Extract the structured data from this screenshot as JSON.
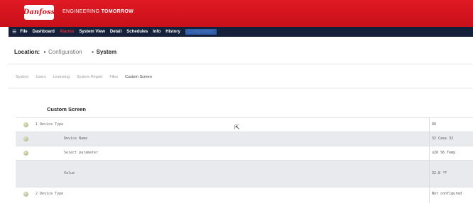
{
  "header": {
    "logo_text": "Danfoss",
    "tagline_a": "ENGINEERING",
    "tagline_b": "TOMORROW"
  },
  "menu": {
    "icon": "hamburger-icon",
    "items": [
      "File",
      "Dashboard",
      "Alarms",
      "System View",
      "Detail",
      "Schedules",
      "Info",
      "History",
      "Configuration"
    ]
  },
  "location": {
    "label": "Location:",
    "crumbs": [
      "Configuration",
      "System"
    ]
  },
  "subtabs": [
    "System",
    "Users",
    "Licensing",
    "System Report",
    "Files",
    "Custom Screen"
  ],
  "section_title": "Custom Screen",
  "rows": [
    {
      "label": "1 Device Type",
      "value": "DU"
    },
    {
      "label": "Device Name",
      "value": "32   Case 32"
    },
    {
      "label": "Select parameter",
      "value": "u26 S6 Temp"
    },
    {
      "label": "Value",
      "value": "32.8 °F"
    },
    {
      "label": "2 Device Type",
      "value": "Not configured"
    }
  ],
  "colors": {
    "header_red": "#d3141c",
    "menubar_navy": "#15203a",
    "active_tab_blue": "#2f5fa8",
    "alarm_red": "#e0303a"
  }
}
